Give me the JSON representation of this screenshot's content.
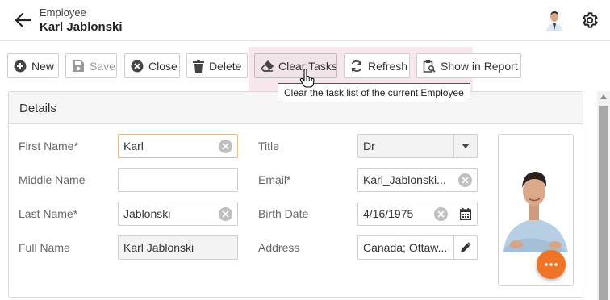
{
  "header": {
    "subtitle": "Employee",
    "title": "Karl Jablonski"
  },
  "toolbar": {
    "new_label": "New",
    "save_label": "Save",
    "close_label": "Close",
    "delete_label": "Delete",
    "clear_tasks_label": "Clear Tasks",
    "refresh_label": "Refresh",
    "show_in_report_label": "Show in Report"
  },
  "tooltip": {
    "text": "Clear the task list of the current Employee"
  },
  "details": {
    "title": "Details",
    "fields": {
      "first_name": {
        "label": "First Name*",
        "value": "Karl"
      },
      "middle_name": {
        "label": "Middle Name",
        "value": ""
      },
      "last_name": {
        "label": "Last Name*",
        "value": "Jablonski"
      },
      "full_name": {
        "label": "Full Name",
        "value": "Karl Jablonski"
      },
      "title": {
        "label": "Title",
        "value": "Dr"
      },
      "email": {
        "label": "Email*",
        "value": "Karl_Jablonski..."
      },
      "birth_date": {
        "label": "Birth Date",
        "value": "4/16/1975"
      },
      "address": {
        "label": "Address",
        "value": "Canada; Ottaw..."
      }
    }
  },
  "colors": {
    "accent_orange": "#f07425",
    "hover_highlight": "#f0d2dc",
    "focused_border": "#e6b98c"
  },
  "icons": [
    "arrow-left-icon",
    "gear-icon",
    "plus-circle-icon",
    "save-icon",
    "close-circle-icon",
    "trash-icon",
    "eraser-icon",
    "refresh-icon",
    "report-icon",
    "clear-x-icon",
    "chevron-down-icon",
    "calendar-icon",
    "pencil-icon",
    "more-dots-icon"
  ]
}
